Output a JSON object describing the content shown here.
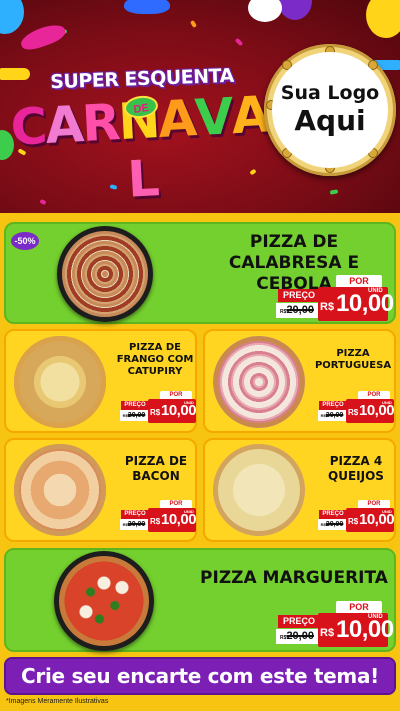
{
  "header": {
    "title_top": "SUPER ESQUENTA",
    "title_de": "DE",
    "title_main_letters": [
      {
        "ch": "C",
        "color": "#e8269a"
      },
      {
        "ch": "A",
        "color": "#f07bd1"
      },
      {
        "ch": "R",
        "color": "#ff4fa8"
      },
      {
        "ch": "N",
        "color": "#ffd419"
      },
      {
        "ch": "A",
        "color": "#ff9b1a"
      },
      {
        "ch": "V",
        "color": "#3ccd4c"
      },
      {
        "ch": "A",
        "color": "#ffb21a"
      },
      {
        "ch": "L",
        "color": "#ff5fb2"
      }
    ],
    "logo_line1": "Sua Logo",
    "logo_line2": "Aqui"
  },
  "colors": {
    "green_card": "#74d02e",
    "yellow_card": "#ffd521",
    "price_red": "#d8121b",
    "cta_purple": "#7b1fb5"
  },
  "discount_badge": "-50%",
  "products": [
    {
      "name": "PIZZA DE CALABRESA E CEBOLA",
      "por": "POR",
      "preco": "PREÇO",
      "old_prefix": "R$",
      "old_value": "20,00",
      "currency": "R$",
      "value": "10,00",
      "unit": "UNID"
    },
    {
      "name": "PIZZA DE FRANGO COM CATUPIRY",
      "por": "POR",
      "preco": "PREÇO",
      "old_prefix": "R$",
      "old_value": "20,00",
      "currency": "R$",
      "value": "10,00",
      "unit": "UNID"
    },
    {
      "name": "PIZZA PORTUGUESA",
      "por": "POR",
      "preco": "PREÇO",
      "old_prefix": "R$",
      "old_value": "20,00",
      "currency": "R$",
      "value": "10,00",
      "unit": "UNID"
    },
    {
      "name": "PIZZA DE BACON",
      "por": "POR",
      "preco": "PREÇO",
      "old_prefix": "R$",
      "old_value": "20,00",
      "currency": "R$",
      "value": "10,00",
      "unit": "UNID"
    },
    {
      "name": "PIZZA 4 QUEIJOS",
      "por": "POR",
      "preco": "PREÇO",
      "old_prefix": "R$",
      "old_value": "20,00",
      "currency": "R$",
      "value": "10,00",
      "unit": "UNID"
    },
    {
      "name": "PIZZA MARGUERITA",
      "por": "POR",
      "preco": "PREÇO",
      "old_prefix": "R$",
      "old_value": "20,00",
      "currency": "R$",
      "value": "10,00",
      "unit": "UNID"
    }
  ],
  "cta": "Crie seu encarte com este tema!",
  "footnote": "*Imagens Meramente Ilustrativas"
}
